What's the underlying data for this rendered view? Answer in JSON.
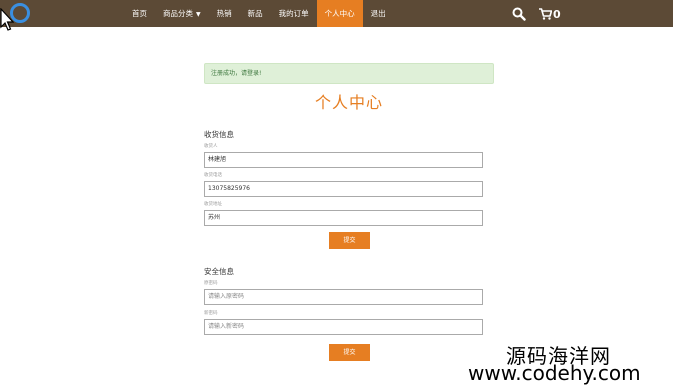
{
  "nav": {
    "items": [
      {
        "label": "首页"
      },
      {
        "label": "商品分类"
      },
      {
        "label": "热销"
      },
      {
        "label": "新品"
      },
      {
        "label": "我的订单"
      },
      {
        "label": "个人中心"
      },
      {
        "label": "退出"
      }
    ],
    "active_index": 5,
    "cart_count": "0",
    "icons": {
      "logo": "ring-logo-icon",
      "search": "search-icon",
      "cart": "cart-icon"
    },
    "colors": {
      "bar": "#5c4a36",
      "active": "#e67e22",
      "logo": "#3a8fe0"
    }
  },
  "alert": {
    "text": "注册成功，请登录!"
  },
  "page_title": "个人中心",
  "shipping": {
    "title": "收货信息",
    "fields": [
      {
        "label": "收货人",
        "value": "林建旭"
      },
      {
        "label": "收货电话",
        "value": "13075825976"
      },
      {
        "label": "收货地址",
        "value": "苏州"
      }
    ],
    "submit_label": "提交"
  },
  "security": {
    "title": "安全信息",
    "fields": [
      {
        "label": "原密码",
        "placeholder": "请输入原密码"
      },
      {
        "label": "新密码",
        "placeholder": "请输入新密码"
      }
    ],
    "submit_label": "提交"
  },
  "watermark": {
    "name": "源码海洋网",
    "url": "www.codehy.com"
  },
  "accent_color": "#e67e22"
}
